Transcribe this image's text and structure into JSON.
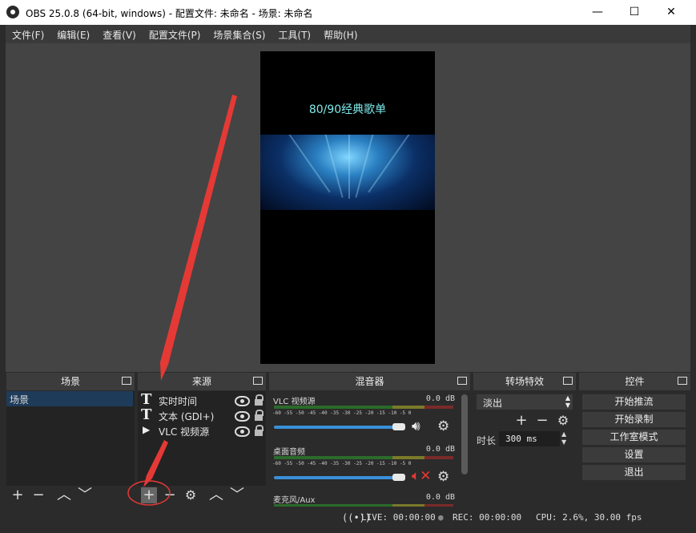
{
  "window": {
    "title": "OBS 25.0.8 (64-bit, windows) - 配置文件: 未命名 - 场景: 未命名",
    "minimize": "—",
    "maximize": "☐",
    "close": "✕"
  },
  "menu": [
    "文件(F)",
    "编辑(E)",
    "查看(V)",
    "配置文件(P)",
    "场景集合(S)",
    "工具(T)",
    "帮助(H)"
  ],
  "preview": {
    "text": "80/90经典歌单"
  },
  "docks": {
    "scenes": {
      "title": "场景",
      "items": [
        "场景"
      ]
    },
    "sources": {
      "title": "来源",
      "items": [
        {
          "label": "实时时间",
          "icon": "text-icon"
        },
        {
          "label": "文本 (GDI+)",
          "icon": "text-icon"
        },
        {
          "label": "VLC 视频源",
          "icon": "play-icon"
        }
      ]
    },
    "mixer": {
      "title": "混音器",
      "scale": "-60 -55 -50 -45 -40 -35 -30 -25 -20 -15 -10 -5 0",
      "channels": [
        {
          "name": "VLC 视频源",
          "db": "0.0 dB",
          "level": 0.95,
          "muted": false
        },
        {
          "name": "桌面音频",
          "db": "0.0 dB",
          "level": 0.95,
          "muted": true
        },
        {
          "name": "麦克风/Aux",
          "db": "0.0 dB",
          "level": 0.95,
          "muted": false
        }
      ]
    },
    "transitions": {
      "title": "转场特效",
      "selected": "淡出",
      "duration_label": "时长",
      "duration_value": "300 ms"
    },
    "controls": {
      "title": "控件",
      "buttons": [
        "开始推流",
        "开始录制",
        "工作室模式",
        "设置",
        "退出"
      ]
    }
  },
  "status": {
    "live": "LIVE: 00:00:00",
    "rec": "REC: 00:00:00",
    "cpu": "CPU: 2.6%, 30.00 fps"
  },
  "colors": {
    "annotation": "#e53935",
    "accent": "#3a8fd9",
    "preview_text": "#7fe9ea"
  }
}
